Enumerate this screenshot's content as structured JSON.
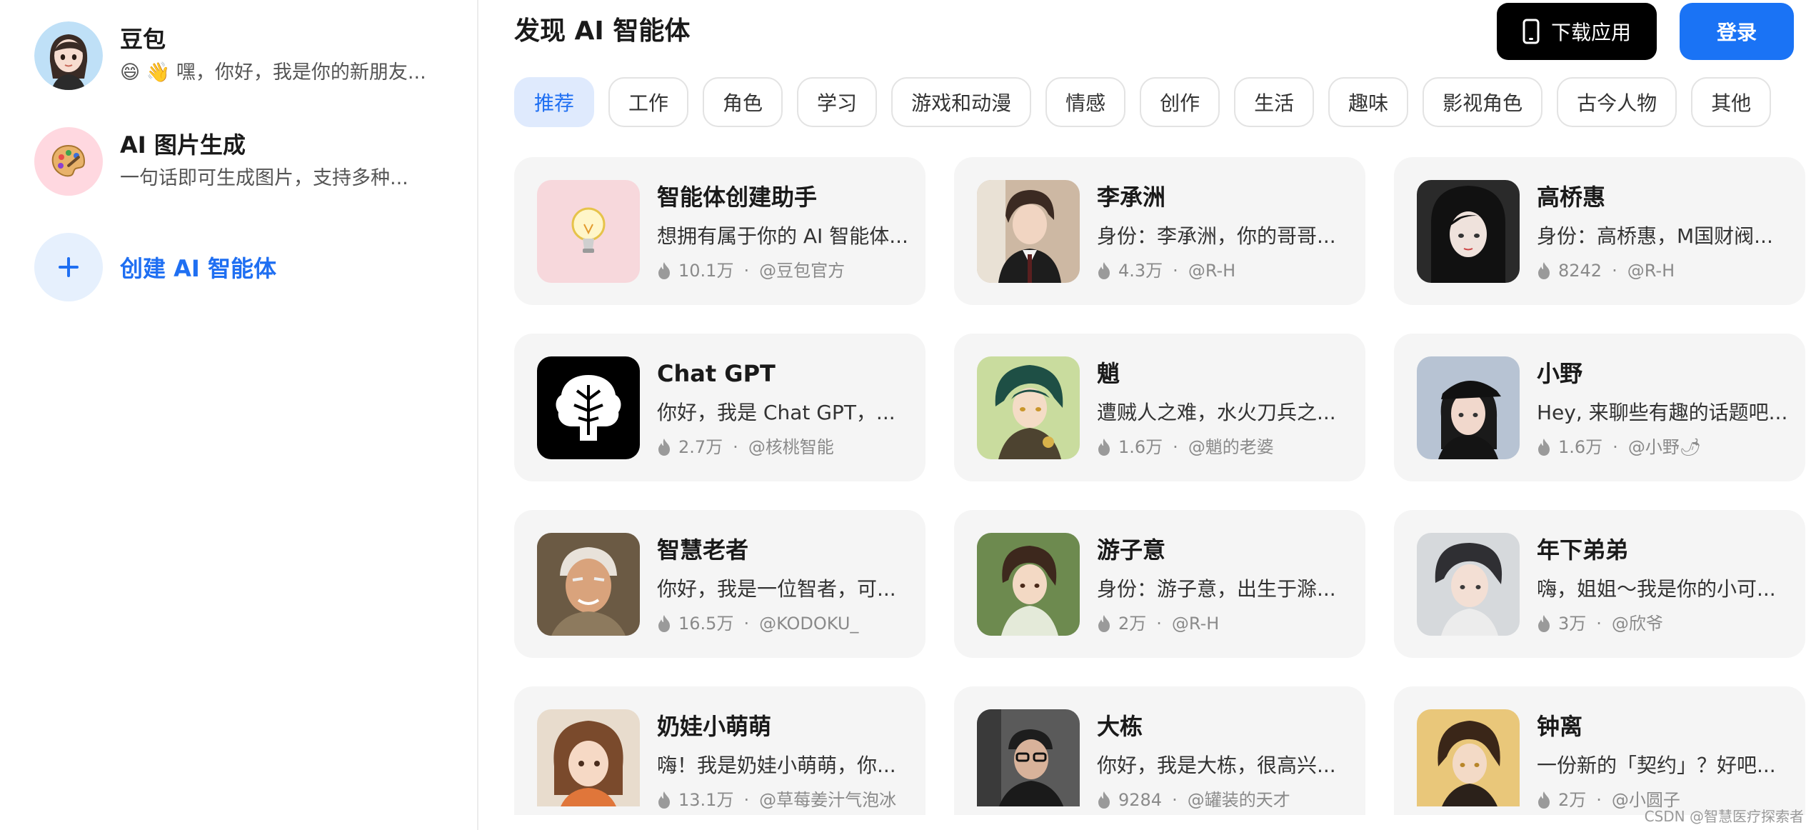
{
  "sidebar": {
    "items": [
      {
        "name": "豆包",
        "desc": "😄 👋 嘿，你好，我是你的新朋友..."
      },
      {
        "name": "AI 图片生成",
        "desc": "一句话即可生成图片，支持多种..."
      }
    ],
    "create_label": "创建 AI 智能体"
  },
  "header": {
    "title": "发现 AI 智能体",
    "download_label": "下载应用",
    "login_label": "登录"
  },
  "tabs": [
    "推荐",
    "工作",
    "角色",
    "学习",
    "游戏和动漫",
    "情感",
    "创作",
    "生活",
    "趣味",
    "影视角色",
    "古今人物",
    "其他"
  ],
  "active_tab": "推荐",
  "cards": [
    {
      "title": "智能体创建助手",
      "desc": "想拥有属于你的 AI 智能体...",
      "heat": "10.1万",
      "author": "@豆包官方"
    },
    {
      "title": "李承洲",
      "desc": "身份：李承洲，你的哥哥...",
      "heat": "4.3万",
      "author": "@R-H"
    },
    {
      "title": "高桥惠",
      "desc": "身份：高桥惠，M国财阀...",
      "heat": "8242",
      "author": "@R-H"
    },
    {
      "title": "Chat GPT",
      "desc": "你好，我是 Chat GPT，...",
      "heat": "2.7万",
      "author": "@核桃智能"
    },
    {
      "title": "魈",
      "desc": "遭贼人之难，水火刀兵之...",
      "heat": "1.6万",
      "author": "@魈的老婆"
    },
    {
      "title": "小野",
      "desc": "Hey, 来聊些有趣的话题吧...",
      "heat": "1.6万",
      "author": "@小野🌶"
    },
    {
      "title": "智慧老者",
      "desc": "你好，我是一位智者，可...",
      "heat": "16.5万",
      "author": "@KODOKU_"
    },
    {
      "title": "游子意",
      "desc": "身份：游子意，出生于滁...",
      "heat": "2万",
      "author": "@R-H"
    },
    {
      "title": "年下弟弟",
      "desc": "嗨，姐姐～我是你的小可...",
      "heat": "3万",
      "author": "@欣爷"
    },
    {
      "title": "奶娃小萌萌",
      "desc": "嗨！我是奶娃小萌萌，你...",
      "heat": "13.1万",
      "author": "@草莓姜汁气泡冰"
    },
    {
      "title": "大栋",
      "desc": "你好，我是大栋，很高兴...",
      "heat": "9284",
      "author": "@罐装的天才"
    },
    {
      "title": "钟离",
      "desc": "一份新的「契约」？好吧...",
      "heat": "2万",
      "author": "@小圆子"
    }
  ],
  "watermark": "CSDN @智慧医疗探索者",
  "colors": {
    "accent": "#1a73f5",
    "active_tab_bg": "#dfeafd",
    "card_bg": "#f5f5f5"
  }
}
